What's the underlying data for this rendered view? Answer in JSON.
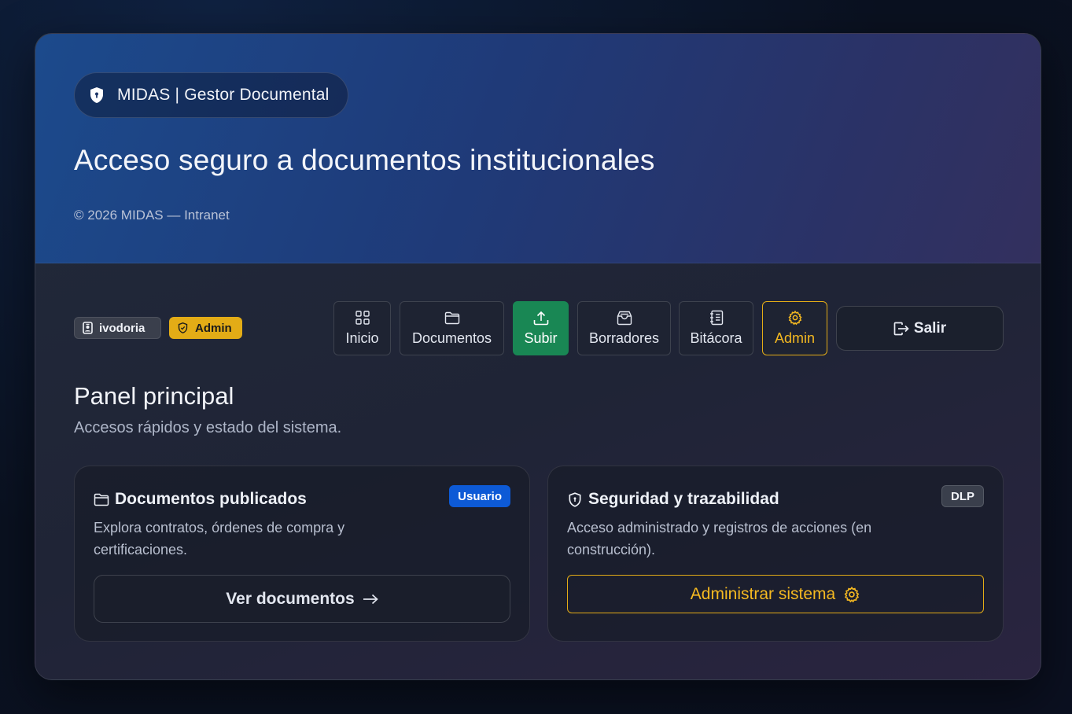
{
  "hero": {
    "brand": "MIDAS | Gestor Documental",
    "title": "Acceso seguro a documentos institucionales",
    "footer": "© 2026 MIDAS — Intranet",
    "brand_icon": "shield-icon"
  },
  "user": {
    "name": "ivodoria",
    "role": "Admin",
    "name_icon": "id-badge-icon",
    "role_icon": "shield-icon"
  },
  "nav": {
    "items": [
      {
        "label": "Inicio",
        "icon": "grid-icon"
      },
      {
        "label": "Documentos",
        "icon": "folder-icon"
      },
      {
        "label": "Subir",
        "icon": "upload-icon",
        "active": true
      },
      {
        "label": "Borradores",
        "icon": "archive-icon"
      },
      {
        "label": "Bitácora",
        "icon": "journal-icon"
      },
      {
        "label": "Admin",
        "icon": "gear-icon"
      }
    ],
    "logout": "Salir"
  },
  "panel": {
    "title": "Panel principal",
    "subtitle": "Accesos rápidos y estado del sistema."
  },
  "cards": [
    {
      "title": "Documentos publicados",
      "badge": "Usuario",
      "description": "Explora contratos, órdenes de compra y certificaciones.",
      "button": "Ver documentos",
      "icon": "folder-icon",
      "button_icon": "arrow-right-icon"
    },
    {
      "title": "Seguridad y trazabilidad",
      "badge": "DLP",
      "description": "Acceso administrado y registros de acciones (en construcción).",
      "button": "Administrar sistema",
      "icon": "shield-icon",
      "button_icon": "gear-icon"
    }
  ],
  "colors": {
    "accent_green": "#198754",
    "accent_yellow": "#e3ac16",
    "badge_blue": "#0d5ad6",
    "hero_start": "#1c4a8c",
    "hero_end": "#33305e"
  }
}
